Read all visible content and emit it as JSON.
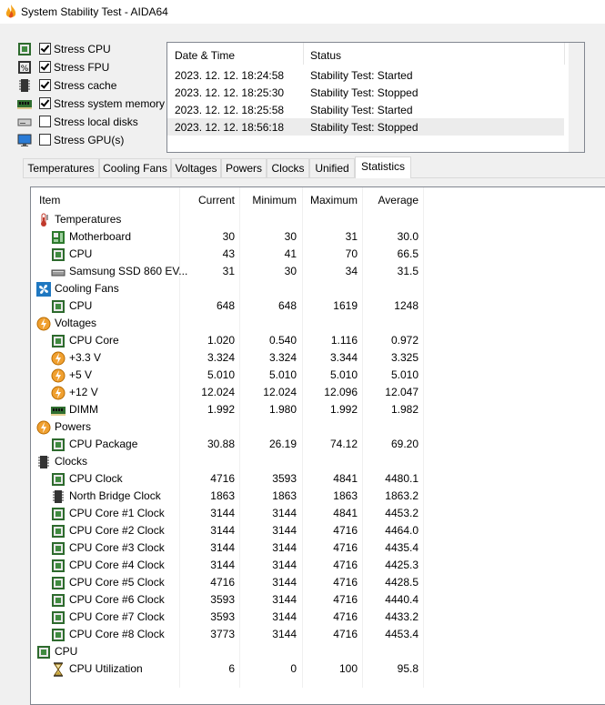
{
  "window": {
    "title": "System Stability Test - AIDA64"
  },
  "options": [
    {
      "label": "Stress CPU",
      "checked": true,
      "icon": "cpu-chip-icon"
    },
    {
      "label": "Stress FPU",
      "checked": true,
      "icon": "fpu-percent-icon"
    },
    {
      "label": "Stress cache",
      "checked": true,
      "icon": "cache-chip-icon"
    },
    {
      "label": "Stress system memory",
      "checked": true,
      "icon": "memory-module-icon"
    },
    {
      "label": "Stress local disks",
      "checked": false,
      "icon": "disk-drive-icon"
    },
    {
      "label": "Stress GPU(s)",
      "checked": false,
      "icon": "monitor-icon"
    }
  ],
  "log": {
    "headers": {
      "datetime": "Date & Time",
      "status": "Status"
    },
    "rows": [
      {
        "datetime": "2023. 12. 12. 18:24:58",
        "status": "Stability Test: Started"
      },
      {
        "datetime": "2023. 12. 12. 18:25:30",
        "status": "Stability Test: Stopped"
      },
      {
        "datetime": "2023. 12. 12. 18:25:58",
        "status": "Stability Test: Started"
      },
      {
        "datetime": "2023. 12. 12. 18:56:18",
        "status": "Stability Test: Stopped"
      }
    ]
  },
  "tabs": [
    "Temperatures",
    "Cooling Fans",
    "Voltages",
    "Powers",
    "Clocks",
    "Unified",
    "Statistics"
  ],
  "active_tab": "Statistics",
  "stats": {
    "headers": {
      "item": "Item",
      "current": "Current",
      "minimum": "Minimum",
      "maximum": "Maximum",
      "average": "Average"
    },
    "rows": [
      {
        "type": "group",
        "label": "Temperatures",
        "icon": "thermometer-icon"
      },
      {
        "type": "item",
        "label": "Motherboard",
        "icon": "motherboard-icon",
        "current": "30",
        "minimum": "30",
        "maximum": "31",
        "average": "30.0"
      },
      {
        "type": "item",
        "label": "CPU",
        "icon": "cpu-chip-icon",
        "current": "43",
        "minimum": "41",
        "maximum": "70",
        "average": "66.5"
      },
      {
        "type": "item",
        "label": "Samsung SSD 860 EV...",
        "icon": "ssd-drive-icon",
        "current": "31",
        "minimum": "30",
        "maximum": "34",
        "average": "31.5"
      },
      {
        "type": "group",
        "label": "Cooling Fans",
        "icon": "fan-icon"
      },
      {
        "type": "item",
        "label": "CPU",
        "icon": "cpu-chip-icon",
        "current": "648",
        "minimum": "648",
        "maximum": "1619",
        "average": "1248"
      },
      {
        "type": "group",
        "label": "Voltages",
        "icon": "voltage-icon"
      },
      {
        "type": "item",
        "label": "CPU Core",
        "icon": "cpu-chip-icon",
        "current": "1.020",
        "minimum": "0.540",
        "maximum": "1.116",
        "average": "0.972"
      },
      {
        "type": "item",
        "label": "+3.3 V",
        "icon": "voltage-icon",
        "current": "3.324",
        "minimum": "3.324",
        "maximum": "3.344",
        "average": "3.325"
      },
      {
        "type": "item",
        "label": "+5 V",
        "icon": "voltage-icon",
        "current": "5.010",
        "minimum": "5.010",
        "maximum": "5.010",
        "average": "5.010"
      },
      {
        "type": "item",
        "label": "+12 V",
        "icon": "voltage-icon",
        "current": "12.024",
        "minimum": "12.024",
        "maximum": "12.096",
        "average": "12.047"
      },
      {
        "type": "item",
        "label": "DIMM",
        "icon": "memory-module-icon",
        "current": "1.992",
        "minimum": "1.980",
        "maximum": "1.992",
        "average": "1.982"
      },
      {
        "type": "group",
        "label": "Powers",
        "icon": "power-icon"
      },
      {
        "type": "item",
        "label": "CPU Package",
        "icon": "cpu-chip-icon",
        "current": "30.88",
        "minimum": "26.19",
        "maximum": "74.12",
        "average": "69.20"
      },
      {
        "type": "group",
        "label": "Clocks",
        "icon": "clock-chip-icon"
      },
      {
        "type": "item",
        "label": "CPU Clock",
        "icon": "cpu-chip-icon",
        "current": "4716",
        "minimum": "3593",
        "maximum": "4841",
        "average": "4480.1"
      },
      {
        "type": "item",
        "label": "North Bridge Clock",
        "icon": "clock-chip-icon",
        "current": "1863",
        "minimum": "1863",
        "maximum": "1863",
        "average": "1863.2"
      },
      {
        "type": "item",
        "label": "CPU Core #1 Clock",
        "icon": "cpu-chip-icon",
        "current": "3144",
        "minimum": "3144",
        "maximum": "4841",
        "average": "4453.2"
      },
      {
        "type": "item",
        "label": "CPU Core #2 Clock",
        "icon": "cpu-chip-icon",
        "current": "3144",
        "minimum": "3144",
        "maximum": "4716",
        "average": "4464.0"
      },
      {
        "type": "item",
        "label": "CPU Core #3 Clock",
        "icon": "cpu-chip-icon",
        "current": "3144",
        "minimum": "3144",
        "maximum": "4716",
        "average": "4435.4"
      },
      {
        "type": "item",
        "label": "CPU Core #4 Clock",
        "icon": "cpu-chip-icon",
        "current": "3144",
        "minimum": "3144",
        "maximum": "4716",
        "average": "4425.3"
      },
      {
        "type": "item",
        "label": "CPU Core #5 Clock",
        "icon": "cpu-chip-icon",
        "current": "4716",
        "minimum": "3144",
        "maximum": "4716",
        "average": "4428.5"
      },
      {
        "type": "item",
        "label": "CPU Core #6 Clock",
        "icon": "cpu-chip-icon",
        "current": "3593",
        "minimum": "3144",
        "maximum": "4716",
        "average": "4440.4"
      },
      {
        "type": "item",
        "label": "CPU Core #7 Clock",
        "icon": "cpu-chip-icon",
        "current": "3593",
        "minimum": "3144",
        "maximum": "4716",
        "average": "4433.2"
      },
      {
        "type": "item",
        "label": "CPU Core #8 Clock",
        "icon": "cpu-chip-icon",
        "current": "3773",
        "minimum": "3144",
        "maximum": "4716",
        "average": "4453.4"
      },
      {
        "type": "group",
        "label": "CPU",
        "icon": "cpu-chip-icon"
      },
      {
        "type": "item",
        "label": "CPU Utilization",
        "icon": "hourglass-icon",
        "current": "6",
        "minimum": "0",
        "maximum": "100",
        "average": "95.8"
      }
    ]
  }
}
